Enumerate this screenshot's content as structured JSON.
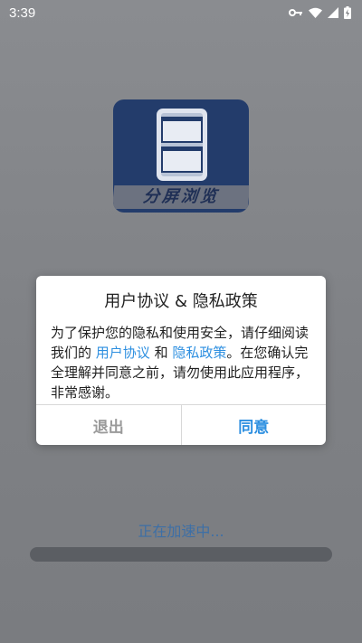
{
  "status_bar": {
    "time": "3:39",
    "icons": [
      "key-icon",
      "wifi-icon",
      "signal-icon",
      "battery-charging-icon"
    ]
  },
  "splash": {
    "logo_text": "分屏浏览",
    "logo_color": "#233c6b",
    "loading_text": "正在加速中..."
  },
  "dialog": {
    "title": "用户协议 & 隐私政策",
    "body_part1": "为了保护您的隐私和使用安全，请仔细阅读我们的 ",
    "link_user_agreement": "用户协议",
    "body_and": " 和 ",
    "link_privacy_policy": "隐私政策",
    "body_part2": "。在您确认完全理解并同意之前，请勿使用此应用程序，非常感谢。",
    "exit_label": "退出",
    "agree_label": "同意",
    "accent_color": "#2d8fe0"
  }
}
